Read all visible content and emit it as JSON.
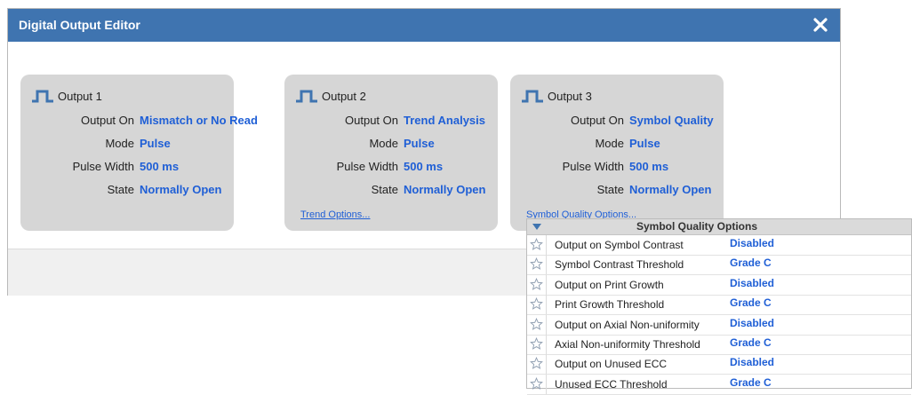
{
  "dialog": {
    "title": "Digital Output Editor",
    "close_icon": "close-icon"
  },
  "colors": {
    "titlebar": "#3f74b0",
    "value_blue": "#1f5fd6",
    "card_bg": "#d6d6d6"
  },
  "labels": {
    "output_on": "Output On",
    "mode": "Mode",
    "pulse_width": "Pulse Width",
    "state": "State"
  },
  "outputs": [
    {
      "title": "Output 1",
      "icon": "pulse-icon",
      "output_on": "Mismatch or No Read",
      "mode": "Pulse",
      "pulse_width": "500 ms",
      "state": "Normally Open",
      "options_link": ""
    },
    {
      "title": "Output 2",
      "icon": "pulse-icon",
      "output_on": "Trend Analysis",
      "mode": "Pulse",
      "pulse_width": "500 ms",
      "state": "Normally Open",
      "options_link": "Trend Options..."
    },
    {
      "title": "Output 3",
      "icon": "pulse-icon",
      "output_on": "Symbol Quality",
      "mode": "Pulse",
      "pulse_width": "500 ms",
      "state": "Normally Open",
      "options_link": "Symbol Quality Options..."
    }
  ],
  "symbol_quality_panel": {
    "title": "Symbol Quality Options",
    "collapse_icon": "triangle-down-icon",
    "rows": [
      {
        "label": "Output on Symbol Contrast",
        "value": "Disabled",
        "icon": "star-icon"
      },
      {
        "label": "Symbol Contrast Threshold",
        "value": "Grade C",
        "icon": "star-icon"
      },
      {
        "label": "Output on Print Growth",
        "value": "Disabled",
        "icon": "star-icon"
      },
      {
        "label": "Print Growth Threshold",
        "value": "Grade C",
        "icon": "star-icon"
      },
      {
        "label": "Output on Axial Non-uniformity",
        "value": "Disabled",
        "icon": "star-icon"
      },
      {
        "label": "Axial Non-uniformity Threshold",
        "value": "Grade C",
        "icon": "star-icon"
      },
      {
        "label": "Output on Unused ECC",
        "value": "Disabled",
        "icon": "star-icon"
      },
      {
        "label": "Unused ECC Threshold",
        "value": "Grade C",
        "icon": "star-icon"
      }
    ]
  }
}
